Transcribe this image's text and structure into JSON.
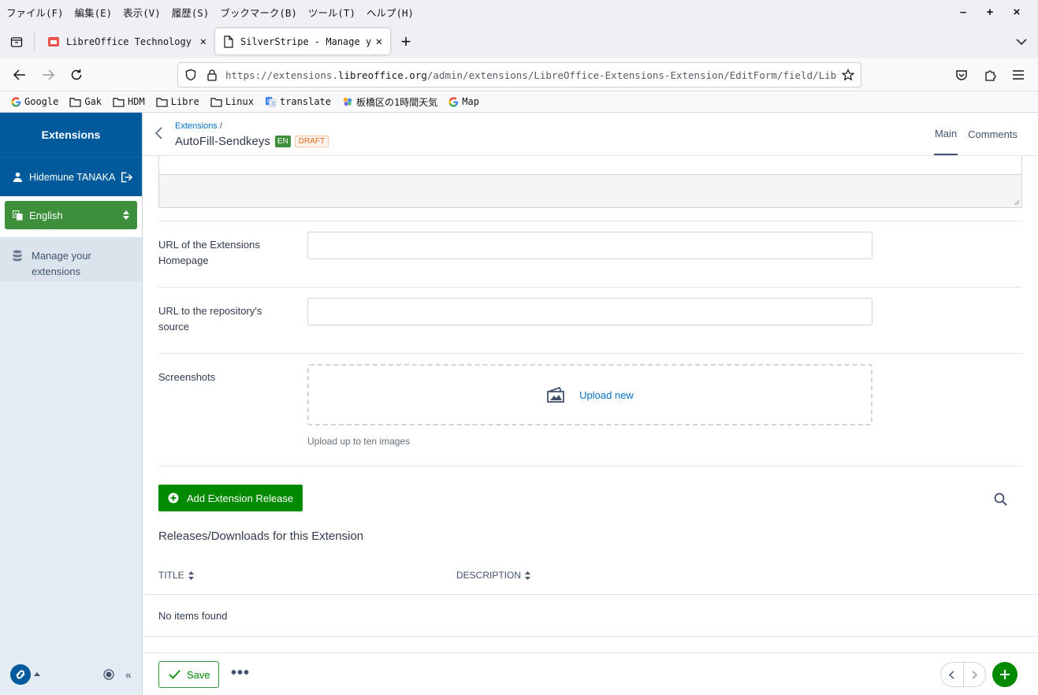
{
  "browser": {
    "menu": [
      "ファイル(F)",
      "編集(E)",
      "表示(V)",
      "履歴(S)",
      "ブックマーク(B)",
      "ツール(T)",
      "ヘルプ(H)"
    ],
    "window_controls": [
      "–",
      "+",
      "×"
    ],
    "tabs": [
      {
        "title": "LibreOffice Technology Ad",
        "active": false
      },
      {
        "title": "SilverStripe - Manage you",
        "active": true
      }
    ],
    "url_prefix": "https://extensions.",
    "url_domain": "libreoffice.org",
    "url_rest": "/admin/extensions/LibreOffice-Extensions-Extension/EditForm/field/LibreOffice",
    "bookmarks": [
      "Google",
      "Gak",
      "HDM",
      "Libre",
      "Linux",
      "translate",
      "板橋区の1時間天気",
      "Map"
    ]
  },
  "cms": {
    "brand": "Extensions",
    "member": "Hidemune TANAKA",
    "language": "English",
    "nav": [
      {
        "label": "Manage your extensions"
      }
    ]
  },
  "header": {
    "breadcrumb": "Extensions",
    "breadcrumb_sep": "/",
    "title": "AutoFill-Sendkeys",
    "badge_locale": "EN",
    "badge_status": "DRAFT",
    "tabs": [
      "Main",
      "Comments"
    ]
  },
  "form": {
    "homepage_label": "URL of the Extensions Homepage",
    "homepage_value": "",
    "repo_label": "URL to the repository's source",
    "repo_value": "",
    "screenshots_label": "Screenshots",
    "upload_label": "Upload new",
    "upload_hint": "Upload up to ten images"
  },
  "releases": {
    "add_button": "Add Extension Release",
    "title": "Releases/Downloads for this Extension",
    "columns": [
      "TITLE",
      "DESCRIPTION"
    ],
    "empty": "No items found"
  },
  "footer": {
    "save": "Save",
    "more": "•••"
  },
  "colors": {
    "brand_blue": "#005a9c",
    "green": "#008a00",
    "link": "#0071c4"
  }
}
